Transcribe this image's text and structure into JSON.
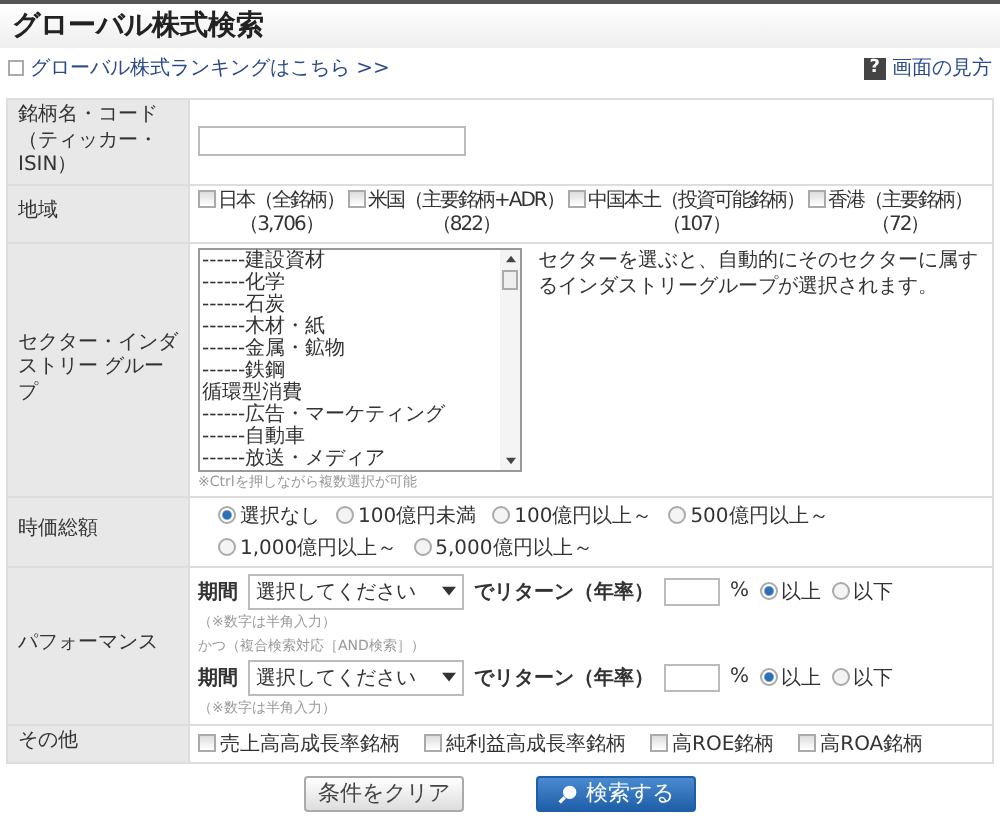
{
  "header": {
    "title": "グローバル株式検索"
  },
  "links": {
    "ranking": "グローバル株式ランキングはこちら >>",
    "help_icon": "?",
    "help": "画面の見方"
  },
  "name_code": {
    "label": "銘柄名・コード",
    "sublabel": "（ティッカー・ISIN）"
  },
  "region": {
    "label": "地域",
    "options": [
      {
        "label": "日本（全銘柄）",
        "count": "（3,706）",
        "checked": false
      },
      {
        "label": "米国（主要銘柄+ADR）",
        "count": "（822）",
        "checked": false
      },
      {
        "label": "中国本土（投資可能銘柄）",
        "count": "（107）",
        "checked": false
      },
      {
        "label": "香港（主要銘柄）",
        "count": "（72）",
        "checked": false
      }
    ]
  },
  "sector": {
    "label": "セクター・インダストリー グループ",
    "items": [
      "------建設資材",
      "------化学",
      "------石炭",
      "------木材・紙",
      "------金属・鉱物",
      "------鉄鋼",
      "循環型消費",
      "------広告・マーケティング",
      "------自動車",
      "------放送・メディア"
    ],
    "description": "セクターを選ぶと、自動的にそのセクターに属するインダストリーグループが選択されます。",
    "note": "※Ctrlを押しながら複数選択が可能"
  },
  "market_cap": {
    "label": "時価総額",
    "options": [
      {
        "label": "選択なし",
        "selected": true
      },
      {
        "label": "100億円未満",
        "selected": false
      },
      {
        "label": "100億円以上～",
        "selected": false
      },
      {
        "label": "500億円以上～",
        "selected": false
      },
      {
        "label": "1,000億円以上～",
        "selected": false
      },
      {
        "label": "5,000億円以上～",
        "selected": false
      }
    ]
  },
  "performance": {
    "label": "パフォーマンス",
    "joiner": "かつ（複合検索対応［AND検索］）",
    "conditions": [
      {
        "period_label": "期間",
        "select_placeholder": "選択してください",
        "return_label": "でリターン（年率）",
        "unit": "%",
        "note": "（※数字は半角入力）",
        "options": [
          {
            "label": "以上",
            "selected": true
          },
          {
            "label": "以下",
            "selected": false
          }
        ]
      },
      {
        "period_label": "期間",
        "select_placeholder": "選択してください",
        "return_label": "でリターン（年率）",
        "unit": "%",
        "note": "（※数字は半角入力）",
        "options": [
          {
            "label": "以上",
            "selected": true
          },
          {
            "label": "以下",
            "selected": false
          }
        ]
      }
    ]
  },
  "other": {
    "label": "その他",
    "options": [
      {
        "label": "売上高高成長率銘柄",
        "checked": false
      },
      {
        "label": "純利益高成長率銘柄",
        "checked": false
      },
      {
        "label": "高ROE銘柄",
        "checked": false
      },
      {
        "label": "高ROA銘柄",
        "checked": false
      }
    ]
  },
  "buttons": [
    {
      "label": "条件をクリア",
      "kind": "secondary"
    },
    {
      "label": "検索する",
      "kind": "primary"
    }
  ]
}
